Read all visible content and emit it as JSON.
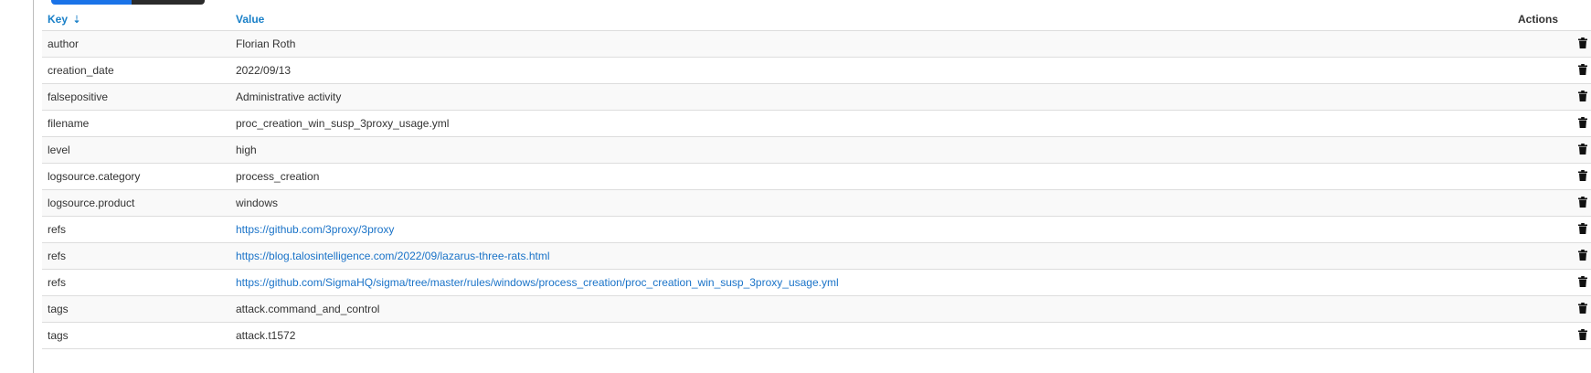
{
  "table": {
    "headers": {
      "key": "Key",
      "sort_indicator": "⇣",
      "value": "Value",
      "actions": "Actions"
    },
    "rows": [
      {
        "key": "author",
        "value": "Florian Roth",
        "is_link": false
      },
      {
        "key": "creation_date",
        "value": "2022/09/13",
        "is_link": false
      },
      {
        "key": "falsepositive",
        "value": "Administrative activity",
        "is_link": false
      },
      {
        "key": "filename",
        "value": "proc_creation_win_susp_3proxy_usage.yml",
        "is_link": false
      },
      {
        "key": "level",
        "value": "high",
        "is_link": false
      },
      {
        "key": "logsource.category",
        "value": "process_creation",
        "is_link": false
      },
      {
        "key": "logsource.product",
        "value": "windows",
        "is_link": false
      },
      {
        "key": "refs",
        "value": "https://github.com/3proxy/3proxy",
        "is_link": true
      },
      {
        "key": "refs",
        "value": "https://blog.talosintelligence.com/2022/09/lazarus-three-rats.html",
        "is_link": true
      },
      {
        "key": "refs",
        "value": "https://github.com/SigmaHQ/sigma/tree/master/rules/windows/process_creation/proc_creation_win_susp_3proxy_usage.yml",
        "is_link": true
      },
      {
        "key": "tags",
        "value": "attack.command_and_control",
        "is_link": false
      },
      {
        "key": "tags",
        "value": "attack.t1572",
        "is_link": false
      }
    ],
    "row_action_icon": "trash-icon"
  },
  "colors": {
    "header_link": "#1a80c8",
    "link": "#1a73c8",
    "tab_active": "#1a73e8",
    "tab_dark": "#2b2b2b",
    "row_alt": "#f9f9f9"
  }
}
